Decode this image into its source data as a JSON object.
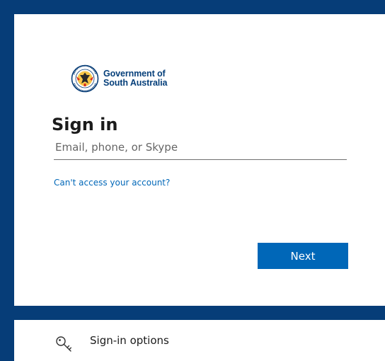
{
  "brand": {
    "logo_line1": "Government of",
    "logo_line2": "South Australia"
  },
  "signin": {
    "title": "Sign in",
    "email_placeholder": "Email, phone, or Skype",
    "email_value": "",
    "cant_access_link": "Can't access your account?",
    "next_label": "Next"
  },
  "options": {
    "label": "Sign-in options",
    "icon": "key-icon"
  },
  "colors": {
    "background": "#063d78",
    "accent": "#0067b8",
    "brand_text": "#053f7a"
  }
}
